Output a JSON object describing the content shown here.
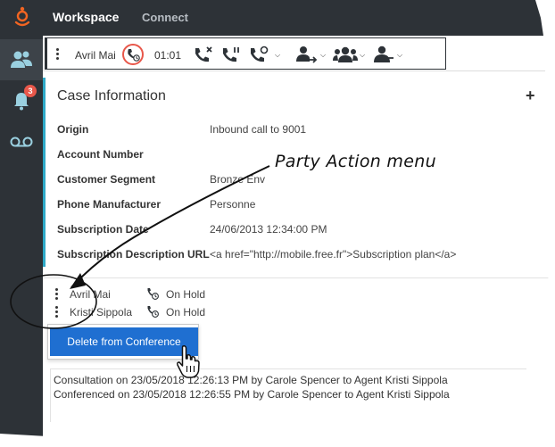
{
  "topnav": {
    "app_name": "Workspace",
    "connect": "Connect"
  },
  "sidebar": {
    "items": [
      {
        "icon": "contacts-icon"
      },
      {
        "icon": "notifications-bell-icon",
        "badge": "3"
      },
      {
        "icon": "voicemail-icon"
      }
    ]
  },
  "toolbar": {
    "party_name": "Avril Mai",
    "timer": "01:01",
    "icons": [
      "end-call-icon",
      "hold-call-icon",
      "consult-call-icon",
      "transfer-icon",
      "conference-icon",
      "party-action-icon"
    ]
  },
  "case": {
    "title": "Case Information",
    "fields": [
      {
        "key": "Origin",
        "value": "Inbound call to 9001"
      },
      {
        "key": "Account Number",
        "value": ""
      },
      {
        "key": "Customer Segment",
        "value": "Bronze Env"
      },
      {
        "key": "Phone Manufacturer",
        "value": "Personne"
      },
      {
        "key": "Subscription Date",
        "value": "24/06/2013 12:34:00 PM"
      },
      {
        "key": "Subscription Description URL",
        "value": "<a href=\"http://mobile.free.fr\">Subscription plan</a>"
      }
    ]
  },
  "parties": [
    {
      "name": "Avril Mai",
      "status": "On Hold"
    },
    {
      "name": "Kristi Sippola",
      "status": "On Hold"
    }
  ],
  "menu": {
    "delete_label": "Delete from Conference"
  },
  "history": {
    "lines": [
      "Consultation on 23/05/2018 12:26:13 PM by Carole Spencer to Agent Kristi Sippola",
      "Conferenced on 23/05/2018 12:26:55 PM by Carole Spencer to Agent Kristi Sippola"
    ]
  },
  "annotation": {
    "label": "Party Action menu"
  },
  "colors": {
    "nav_bg": "#2d3237",
    "accent_blue": "#1f6fd1",
    "case_border": "#2ea9c7",
    "alert_red": "#e8574a"
  }
}
